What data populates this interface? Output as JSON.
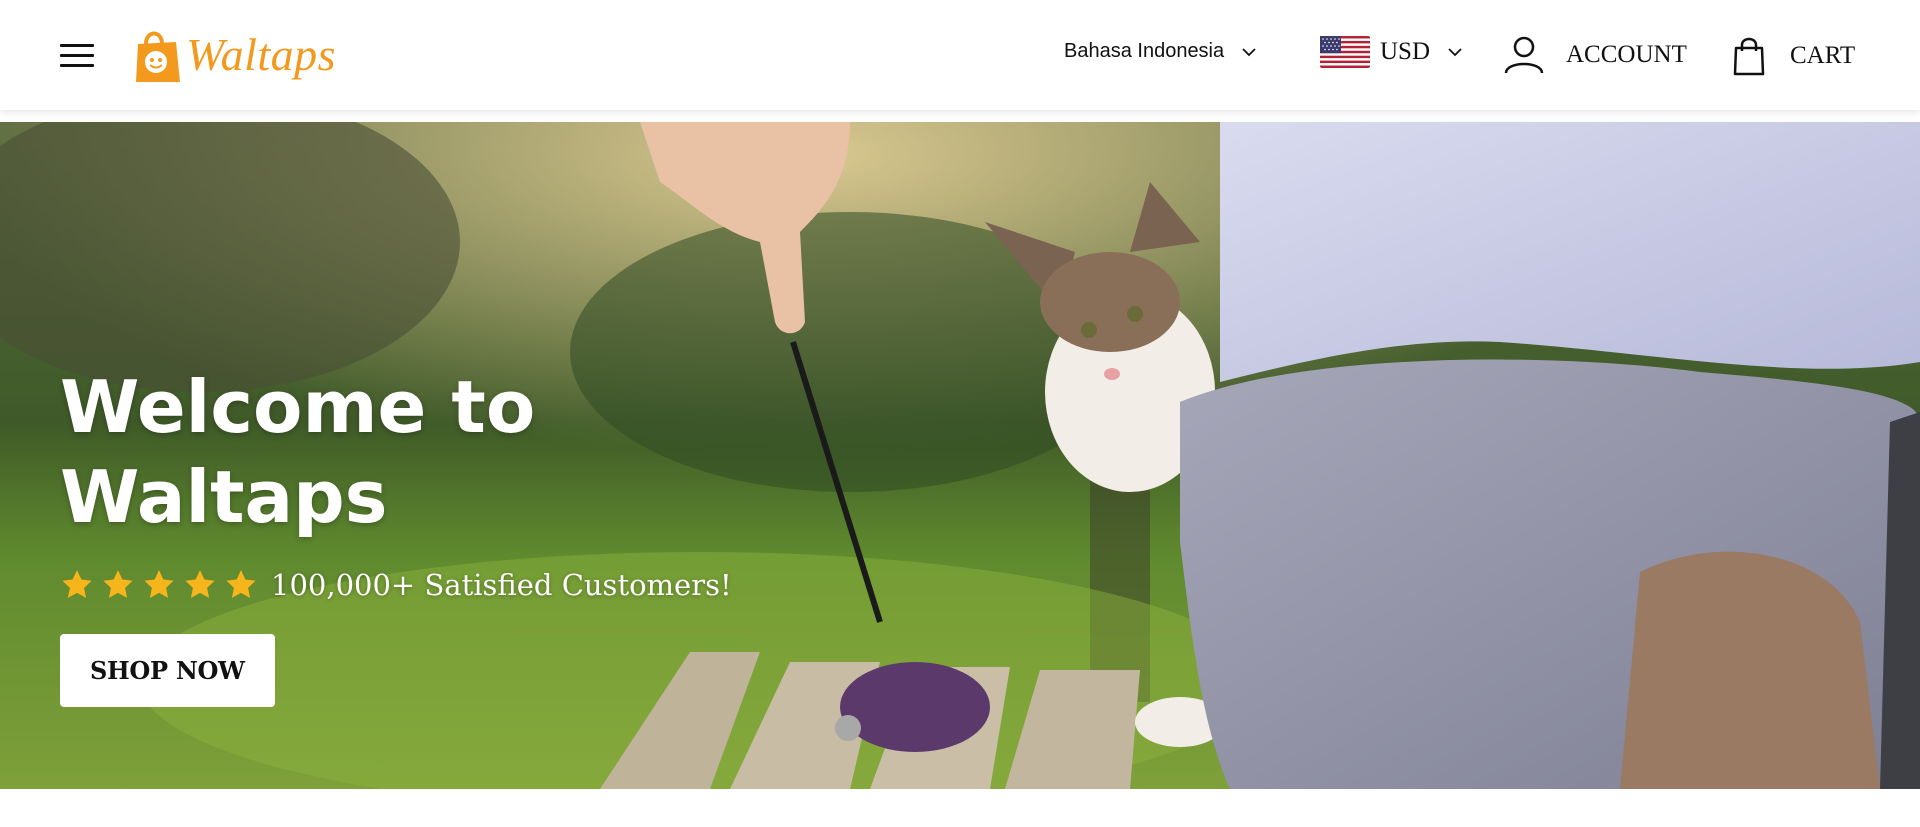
{
  "header": {
    "logo_text": "Waltaps",
    "language": "Bahasa Indonesia",
    "currency": "USD",
    "account_label": "ACCOUNT",
    "cart_label": "CART",
    "brand_color": "#f39a1e"
  },
  "hero": {
    "title_line1": "Welcome to",
    "title_line2": "Waltaps",
    "rating_text": "100,000+ Satisfied Customers!",
    "star_count": 5,
    "cta_label": "SHOP NOW"
  },
  "icons": [
    "hamburger-icon",
    "shopping-bag-logo-icon",
    "chevron-down-icon",
    "us-flag-icon",
    "user-icon",
    "cart-icon",
    "star-icon"
  ]
}
